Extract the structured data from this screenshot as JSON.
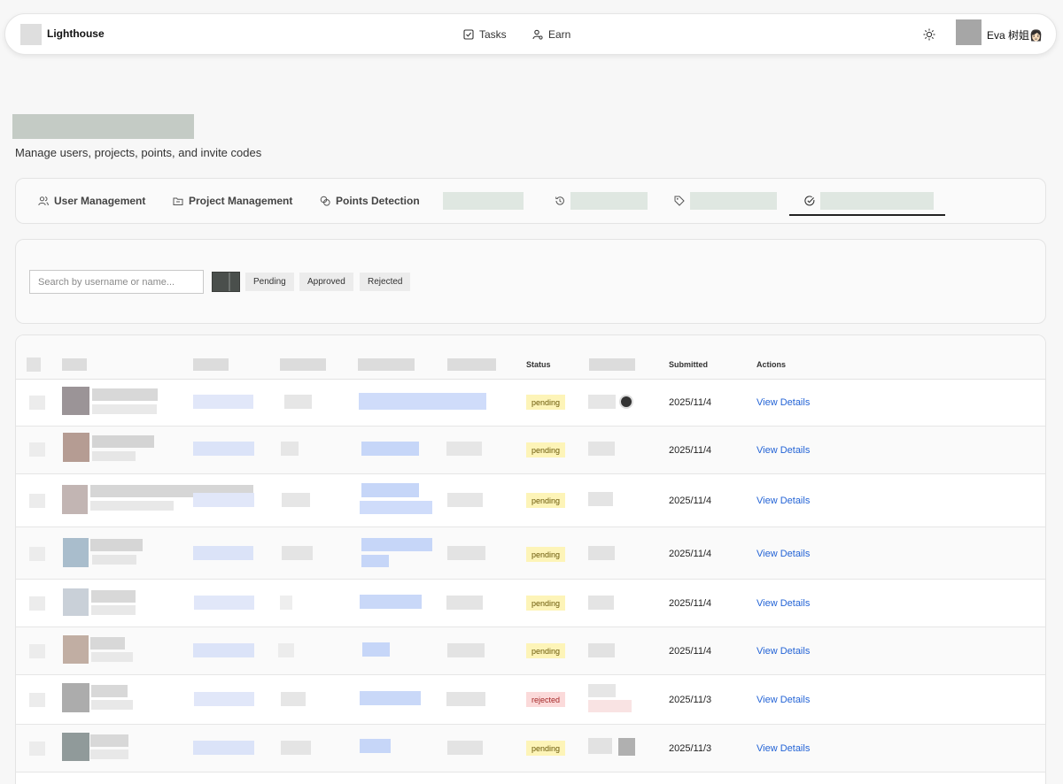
{
  "brand": {
    "name": "Lighthouse"
  },
  "nav": {
    "tasks": "Tasks",
    "earn": "Earn"
  },
  "user": {
    "name": "Eva 树姐👩🏻"
  },
  "page": {
    "subtitle": "Manage users, projects, points, and invite codes"
  },
  "tabs": {
    "user_management": "User Management",
    "project_management": "Project Management",
    "points_detection": "Points Detection"
  },
  "filters": {
    "search_placeholder": "Search by username or name...",
    "pending": "Pending",
    "approved": "Approved",
    "rejected": "Rejected"
  },
  "table": {
    "headers": {
      "status": "Status",
      "submitted": "Submitted",
      "actions": "Actions"
    },
    "rows": [
      {
        "status": "pending",
        "submitted": "2025/11/4",
        "action": "View Details"
      },
      {
        "status": "pending",
        "submitted": "2025/11/4",
        "action": "View Details"
      },
      {
        "status": "pending",
        "submitted": "2025/11/4",
        "action": "View Details"
      },
      {
        "status": "pending",
        "submitted": "2025/11/4",
        "action": "View Details"
      },
      {
        "status": "pending",
        "submitted": "2025/11/4",
        "action": "View Details"
      },
      {
        "status": "pending",
        "submitted": "2025/11/4",
        "action": "View Details"
      },
      {
        "status": "rejected",
        "submitted": "2025/11/3",
        "action": "View Details"
      },
      {
        "status": "pending",
        "submitted": "2025/11/3",
        "action": "View Details"
      }
    ]
  },
  "colors": {
    "accent_link": "#2464d6",
    "pending_badge": "#fdf4b8",
    "rejected_badge": "#fbdada"
  }
}
